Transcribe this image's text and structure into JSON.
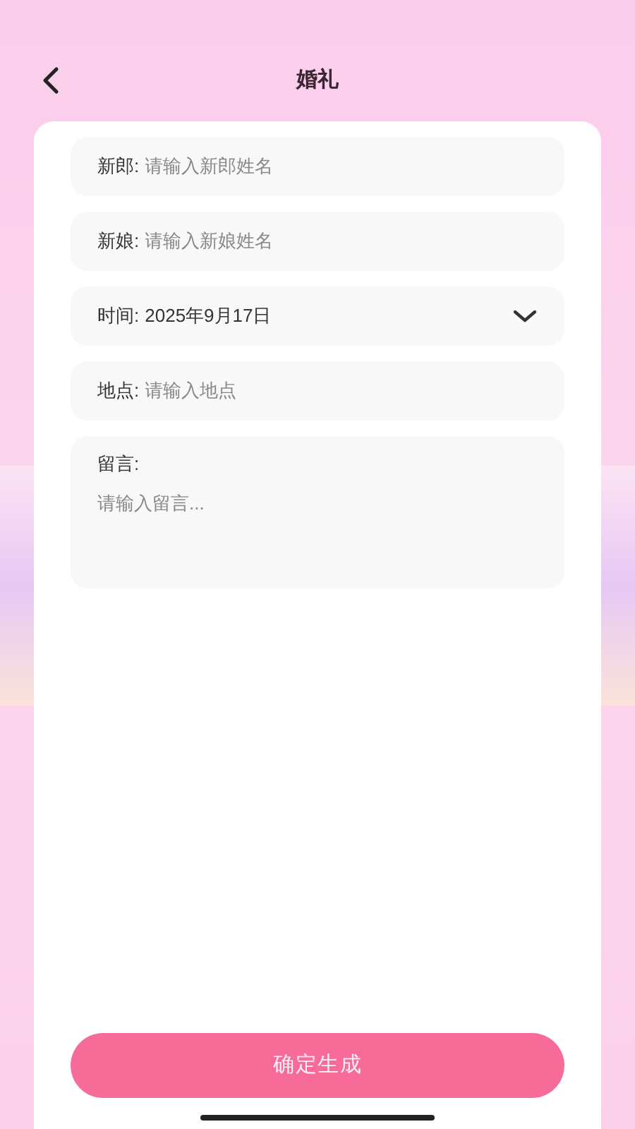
{
  "header": {
    "title": "婚礼"
  },
  "fields": [
    {
      "kind": "text",
      "label": "新郎:",
      "placeholder": "请输入新郎姓名"
    },
    {
      "kind": "text",
      "label": "新娘:",
      "placeholder": "请输入新娘姓名"
    },
    {
      "kind": "select",
      "label": "时间:",
      "value": "2025年9月17日"
    },
    {
      "kind": "text",
      "label": "地点:",
      "placeholder": "请输入地点"
    },
    {
      "kind": "textarea",
      "label": "留言:",
      "placeholder": "请输入留言..."
    }
  ],
  "submit_button": "确定生成"
}
